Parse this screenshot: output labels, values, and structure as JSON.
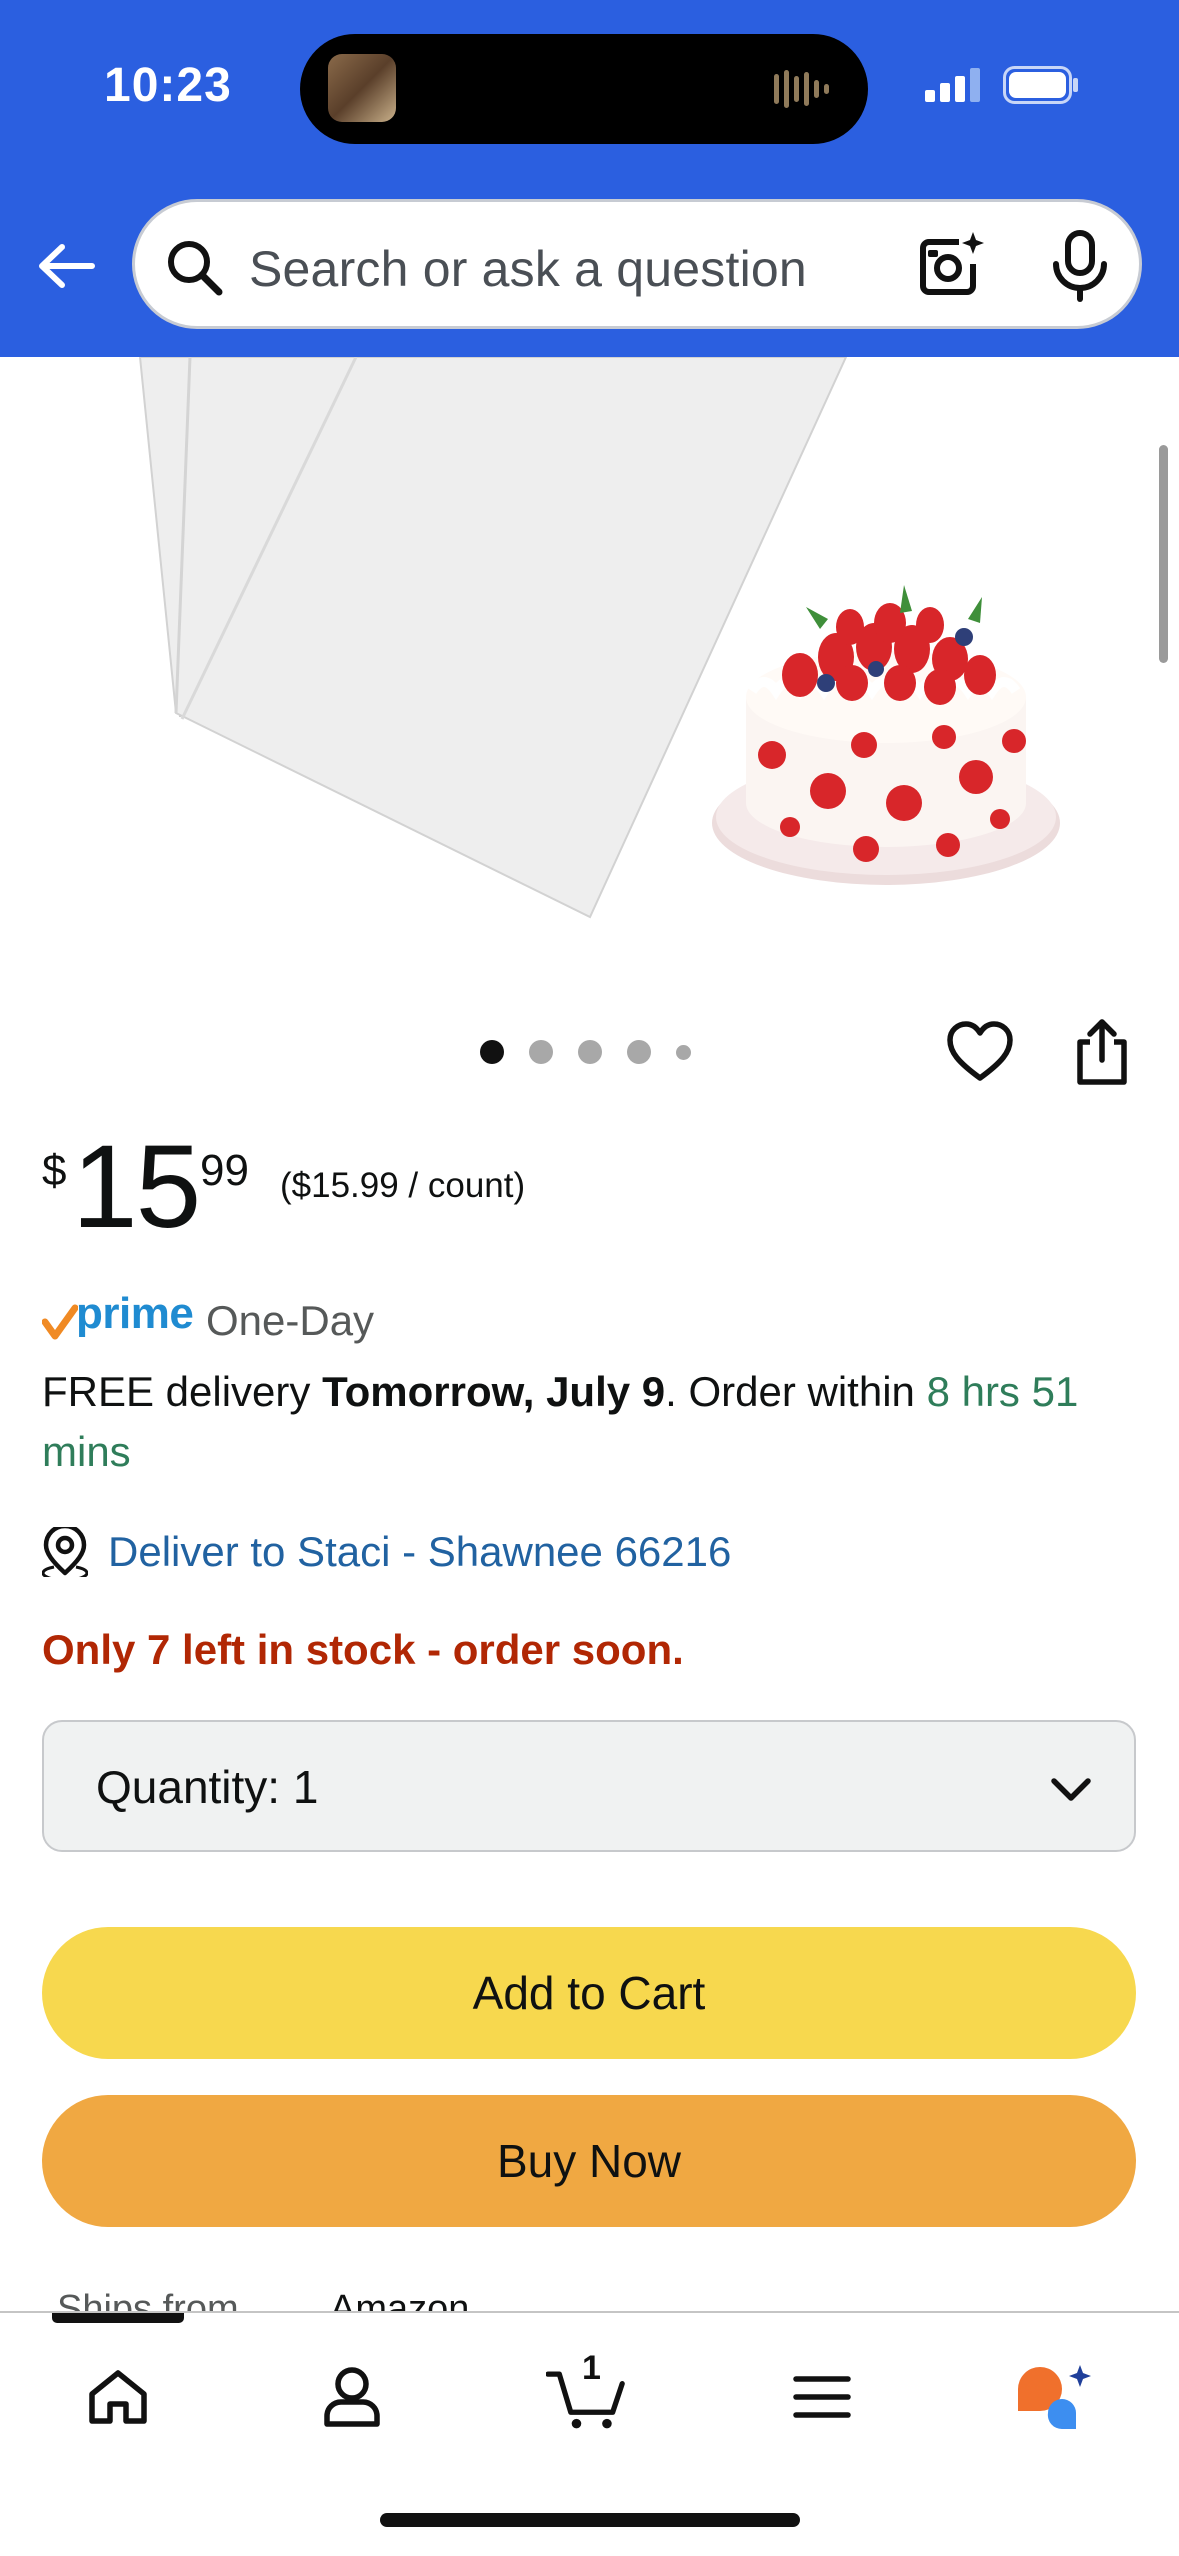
{
  "status_bar": {
    "time": "10:23"
  },
  "search": {
    "placeholder": "Search or ask a question"
  },
  "gallery": {
    "dot_count": 5,
    "active_index": 0
  },
  "price": {
    "currency": "$",
    "whole": "15",
    "fraction": "99",
    "unit_price": "($15.99 / count)"
  },
  "prime": {
    "logo_text": "prime",
    "tier": "One-Day"
  },
  "delivery": {
    "prefix": "FREE delivery ",
    "date": "Tomorrow, July 9",
    "middle": ". Order within ",
    "countdown": "8 hrs 51 mins"
  },
  "deliver_to": {
    "label": "Deliver to Staci - Shawnee 66216"
  },
  "stock": {
    "message": "Only 7 left in stock - order soon."
  },
  "quantity": {
    "label": "Quantity:",
    "value": "1"
  },
  "buttons": {
    "add_to_cart": "Add to Cart",
    "buy_now": "Buy Now"
  },
  "ships_from": {
    "label": "Ships from",
    "value": "Amazon"
  },
  "bottom_nav": {
    "cart_count": "1"
  },
  "colors": {
    "header_blue": "#2b5fe0",
    "prime_blue": "#1f8bd1",
    "link_blue": "#2162a1",
    "stock_red": "#b12704",
    "countdown_green": "#2f7d5a",
    "add_to_cart_yellow": "#f7d84e",
    "buy_now_orange": "#f0a842"
  },
  "icons": [
    "back-arrow-icon",
    "search-icon",
    "camera-lens-icon",
    "microphone-icon",
    "heart-icon",
    "share-icon",
    "location-pin-icon",
    "chevron-down-icon",
    "home-icon",
    "account-icon",
    "cart-icon",
    "menu-icon",
    "assistant-icon"
  ]
}
